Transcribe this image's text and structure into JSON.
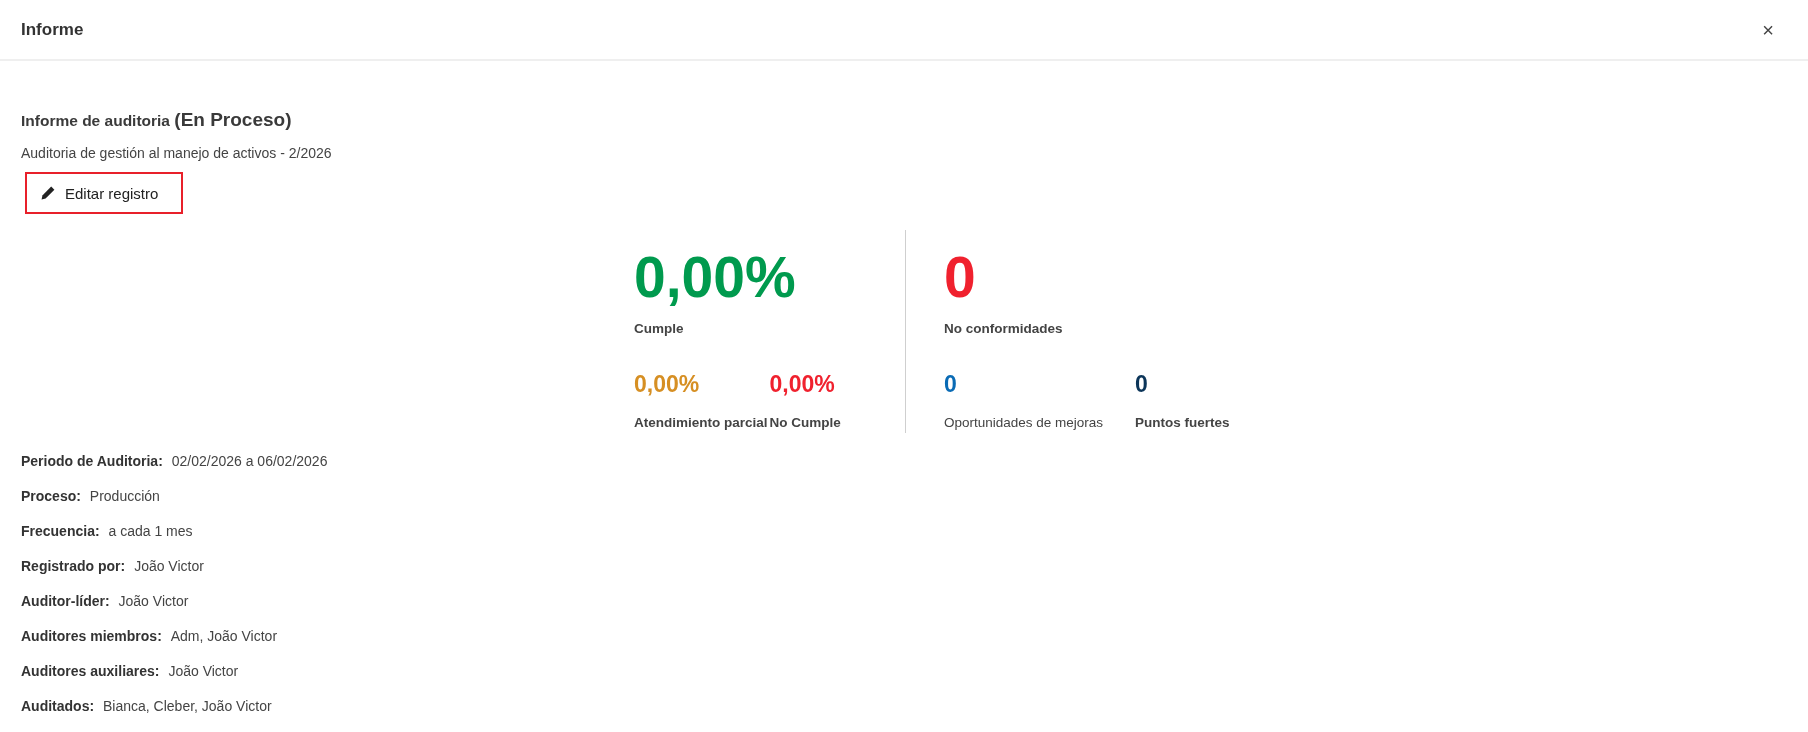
{
  "window": {
    "title": "Informe",
    "close_label": "×"
  },
  "report": {
    "title": "Informe de auditoria",
    "status": "(En Proceso)",
    "subtitle": "Auditoria de gestión al manejo de activos - 2/2026",
    "edit_button": {
      "label": "Editar registro",
      "highlighted": true
    }
  },
  "stats": [
    {
      "main": {
        "value": "0,00%",
        "label": "Cumple",
        "color": "#009a4e"
      },
      "sub": [
        {
          "value": "0,00%",
          "label": "Atendimiento parcial",
          "color": "#d68f23",
          "label_bold": true
        },
        {
          "value": "0,00%",
          "label": "No Cumple",
          "color": "#f0212e",
          "label_bold": true
        }
      ]
    },
    {
      "main": {
        "value": "0",
        "label": "No conformidades",
        "color": "#f0212e"
      },
      "sub": [
        {
          "value": "0",
          "label": "Oportunidades de mejoras",
          "color": "#0a6bb5",
          "label_bold": false
        },
        {
          "value": "0",
          "label": "Puntos fuertes",
          "color": "#0c3559",
          "label_bold": true
        }
      ]
    }
  ],
  "details": [
    {
      "label": "Periodo de Auditoria:",
      "value": "02/02/2026 a 06/02/2026"
    },
    {
      "label": "Proceso:",
      "value": "Producción"
    },
    {
      "label": "Frecuencia:",
      "value": "a cada 1 mes"
    },
    {
      "label": "Registrado por:",
      "value": "João Victor"
    },
    {
      "label": "Auditor-líder:",
      "value": "João Victor"
    },
    {
      "label": "Auditores miembros:",
      "value": "Adm, João Victor"
    },
    {
      "label": "Auditores auxiliares:",
      "value": "João Victor"
    },
    {
      "label": "Auditados:",
      "value": "Bianca, Cleber, João Victor"
    }
  ]
}
